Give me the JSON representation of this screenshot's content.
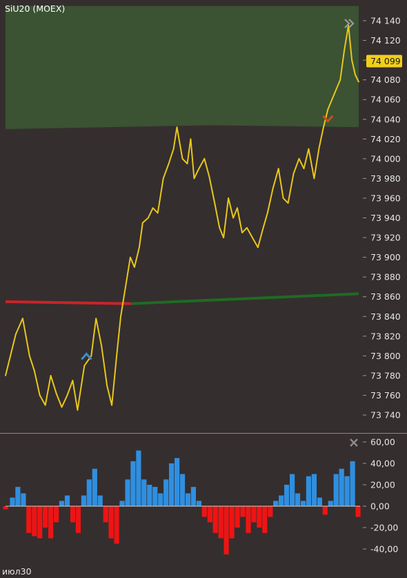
{
  "header": {
    "symbol": "SiU20 (MOEX)"
  },
  "colors": {
    "background": "#352e2e",
    "price_line": "#e8c81a",
    "zone_fill": "#3b5233",
    "ma_below": "#c8242a",
    "ma_above": "#1f6b24",
    "bar_positive": "#2f8fe0",
    "bar_negative": "#ee1414",
    "price_badge": "#f1cf1b",
    "separator": "#8a8a8a"
  },
  "icons": {
    "expand": "double-chevron-right-icon",
    "close": "close-icon",
    "buy_marker": "chevron-up-icon",
    "sell_marker": "chevron-down-icon"
  },
  "price_badge": {
    "label": "74 099",
    "value": 74099
  },
  "x_axis": {
    "label": "июл30"
  },
  "chart_data": [
    {
      "type": "line",
      "panel": "price",
      "title": "SiU20 (MOEX)",
      "ylim": [
        73730,
        74150
      ],
      "y_ticks": [
        73740,
        73760,
        73780,
        73800,
        73820,
        73840,
        73860,
        73880,
        73900,
        73920,
        73940,
        73960,
        73980,
        74000,
        74020,
        74040,
        74060,
        74080,
        74100,
        74120,
        74140
      ],
      "y_tick_labels": [
        "73 740",
        "73 760",
        "73 780",
        "73 800",
        "73 820",
        "73 840",
        "73 860",
        "73 880",
        "73 900",
        "73 920",
        "73 940",
        "73 960",
        "73 980",
        "74 000",
        "74 020",
        "74 040",
        "74 060",
        "74 080",
        "74 100",
        "74 120",
        "74 140"
      ],
      "x_index": [
        0,
        15,
        25,
        35,
        42,
        50,
        58,
        66,
        74,
        82,
        90,
        98,
        105,
        115,
        125,
        132,
        140,
        148,
        155,
        162,
        168,
        175,
        182,
        188,
        195,
        200,
        208,
        215,
        222,
        230,
        238,
        245,
        250,
        258,
        265,
        270,
        275,
        282,
        290,
        297,
        305,
        312,
        318,
        325,
        332,
        338,
        345,
        352,
        360,
        368,
        375,
        382,
        390,
        398,
        405,
        412,
        420,
        428,
        435,
        442,
        450,
        457,
        463,
        470,
        476,
        482,
        488,
        494,
        500,
        505,
        510,
        515
      ],
      "series": [
        {
          "values": [
            73780,
            73822,
            73838,
            73800,
            73785,
            73760,
            73750,
            73780,
            73762,
            73748,
            73760,
            73775,
            73745,
            73790,
            73800,
            73838,
            73810,
            73770,
            73750,
            73800,
            73840,
            73870,
            73900,
            73890,
            73910,
            73935,
            73940,
            73950,
            73945,
            73980,
            73995,
            74010,
            74032,
            74000,
            73995,
            74020,
            73980,
            73990,
            74000,
            73982,
            73955,
            73930,
            73920,
            73960,
            73940,
            73950,
            73925,
            73930,
            73920,
            73910,
            73928,
            73945,
            73970,
            73990,
            73960,
            73955,
            73985,
            74000,
            73990,
            74010,
            73980,
            74010,
            74030,
            74050,
            74060,
            74070,
            74080,
            74110,
            74135,
            74100,
            74085,
            74078
          ]
        }
      ],
      "ma_line": {
        "x_index": [
          0,
          183,
          515
        ],
        "values": [
          73855,
          73853,
          73863
        ],
        "color_below_price": "#c8242a",
        "color_above_price": "#1f6b24",
        "cross_index": 183
      },
      "zone": {
        "top": 74155,
        "bottom_start": 74030,
        "bottom_end": 74032
      },
      "markers": [
        {
          "x_index": 118,
          "value": 73800,
          "kind": "buy",
          "icon": "chevron-up-icon",
          "color": "#3a8fd0"
        },
        {
          "x_index": 470,
          "value": 74040,
          "kind": "sell",
          "icon": "chevron-down-icon",
          "color": "#c8501e"
        }
      ],
      "last_value": 74099
    },
    {
      "type": "bar",
      "panel": "oscillator",
      "ylim": [
        -50,
        65
      ],
      "y_ticks": [
        60,
        40,
        20,
        0,
        -20,
        -40
      ],
      "y_tick_labels": [
        "60,00",
        "40,00",
        "20,00",
        "0,00",
        "-20,00",
        "-40,00"
      ],
      "x_index": [
        0,
        10,
        18,
        26,
        34,
        42,
        50,
        58,
        66,
        74,
        82,
        90,
        98,
        106,
        114,
        122,
        130,
        138,
        146,
        154,
        162,
        170,
        178,
        186,
        194,
        202,
        210,
        218,
        226,
        234,
        242,
        250,
        258,
        266,
        274,
        282,
        290,
        298,
        306,
        314,
        322,
        330,
        338,
        346,
        354,
        362,
        370,
        378,
        386,
        394,
        402,
        410,
        418,
        426,
        434,
        442,
        450,
        458,
        466,
        474,
        482,
        490,
        498,
        506,
        514
      ],
      "values": [
        -3,
        8,
        18,
        12,
        -25,
        -28,
        -30,
        -20,
        -30,
        -15,
        5,
        10,
        -15,
        -25,
        10,
        25,
        35,
        10,
        -15,
        -30,
        -35,
        5,
        25,
        42,
        52,
        25,
        20,
        18,
        12,
        25,
        40,
        45,
        30,
        12,
        18,
        5,
        -10,
        -15,
        -25,
        -30,
        -45,
        -30,
        -20,
        -10,
        -25,
        -15,
        -20,
        -25,
        -10,
        5,
        10,
        20,
        30,
        12,
        5,
        28,
        30,
        8,
        -8,
        5,
        30,
        35,
        28,
        42,
        -10
      ]
    }
  ]
}
